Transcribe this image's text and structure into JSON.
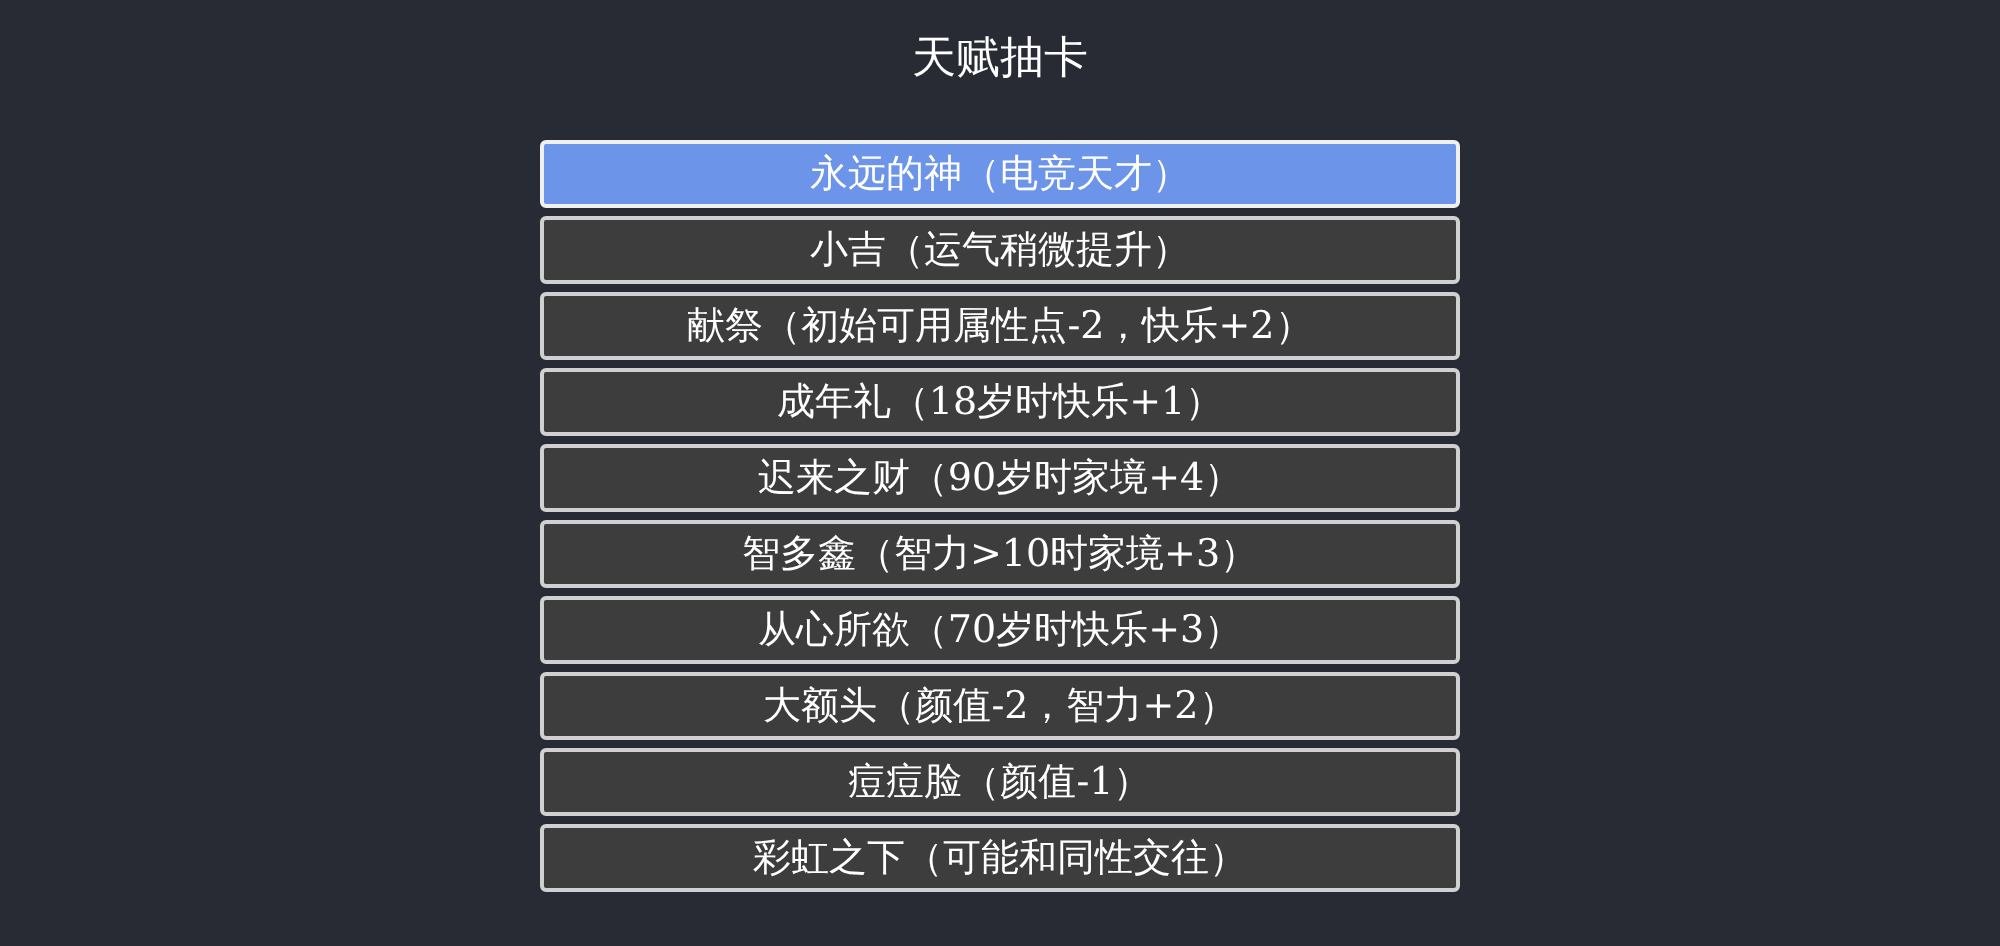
{
  "title": "天赋抽卡",
  "talents": [
    {
      "label": "永远的神（电竞天才）",
      "selected": true
    },
    {
      "label": "小吉（运气稍微提升）",
      "selected": false
    },
    {
      "label": "献祭（初始可用属性点-2，快乐+2）",
      "selected": false
    },
    {
      "label": "成年礼（18岁时快乐+1）",
      "selected": false
    },
    {
      "label": "迟来之财（90岁时家境+4）",
      "selected": false
    },
    {
      "label": "智多鑫（智力>10时家境+3）",
      "selected": false
    },
    {
      "label": "从心所欲（70岁时快乐+3）",
      "selected": false
    },
    {
      "label": "大额头（颜值-2，智力+2）",
      "selected": false
    },
    {
      "label": "痘痘脸（颜值-1）",
      "selected": false
    },
    {
      "label": "彩虹之下（可能和同性交往）",
      "selected": false
    }
  ]
}
